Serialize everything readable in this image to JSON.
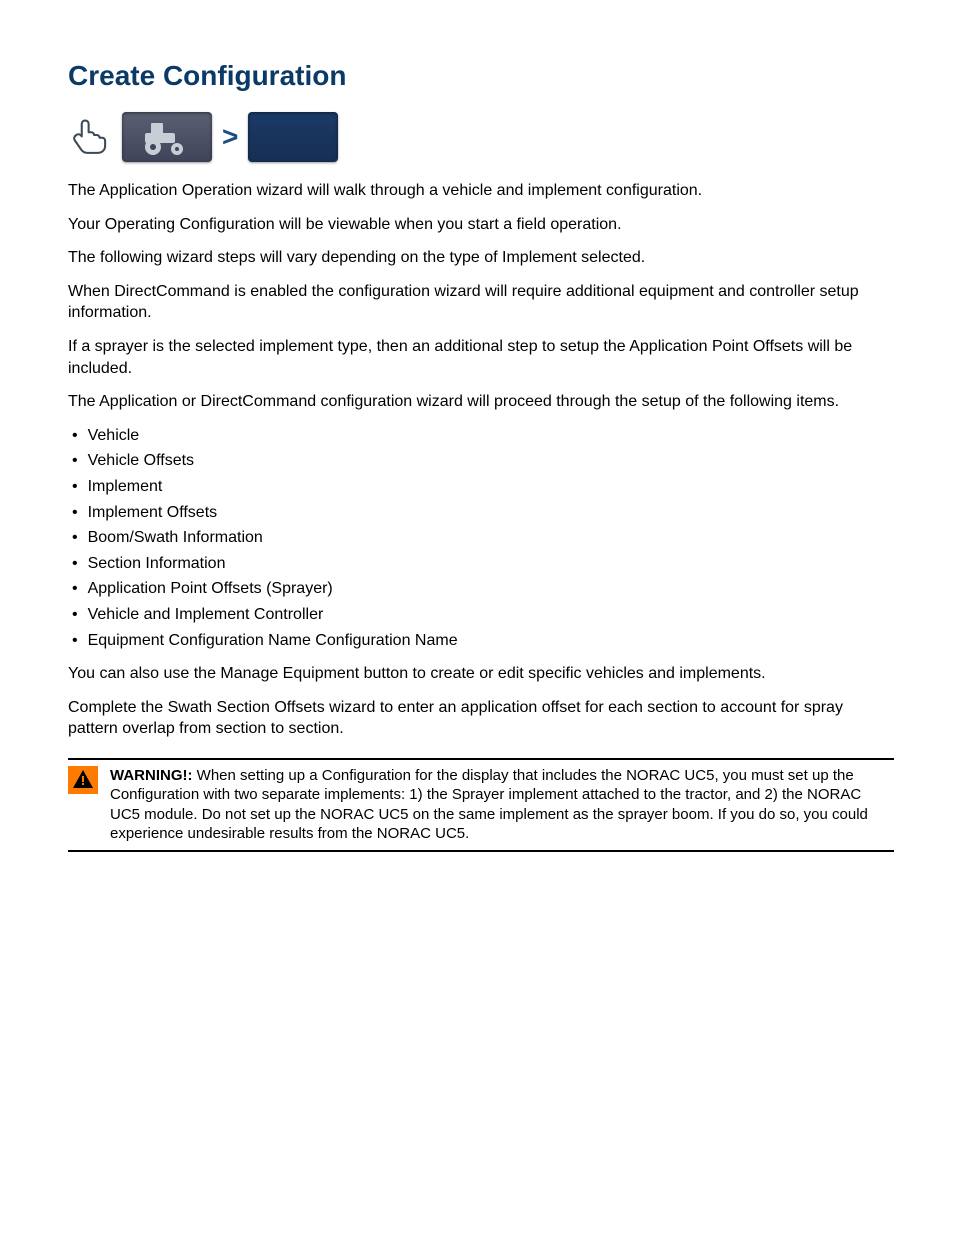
{
  "title": "Create Configuration",
  "paragraphs": {
    "intro1": "The Application Operation wizard will walk through a vehicle and implement configuration.",
    "intro2": "Your Operating Configuration will be viewable when you start a field operation.",
    "intro3": "The following wizard steps will vary depending on the type of Implement selected.",
    "intro4": "When DirectCommand is enabled the configuration wizard will require additional equipment and controller setup information.",
    "intro5": "If a sprayer is the selected implement type, then an additional step to setup the Application Point Offsets will be included.",
    "intro6": "The Application or DirectCommand configuration wizard will proceed through the setup of the following items."
  },
  "bullets": [
    "Vehicle",
    "Vehicle Offsets",
    "Implement",
    "Implement Offsets",
    "Boom/Swath Information",
    "Section Information",
    "Application Point Offsets (Sprayer)",
    "Vehicle and Implement Controller",
    "Equipment Configuration Name Configuration Name"
  ],
  "closing": {
    "p1": "You can also use the Manage Equipment button to create or edit specific vehicles and implements.",
    "p2": "Complete the Swath Section Offsets wizard to enter an application offset for each section to account for spray pattern overlap from section to section."
  },
  "warning": {
    "label": "WARNING!:",
    "text": "When setting up a Configuration for the display that includes the NORAC UC5, you must set up the Configuration with two separate implements: 1) the Sprayer implement attached to the tractor, and 2) the NORAC UC5 module. Do not set up the NORAC UC5 on the same implement as the sprayer boom. If you do so, you could experience undesirable results from the NORAC UC5."
  }
}
